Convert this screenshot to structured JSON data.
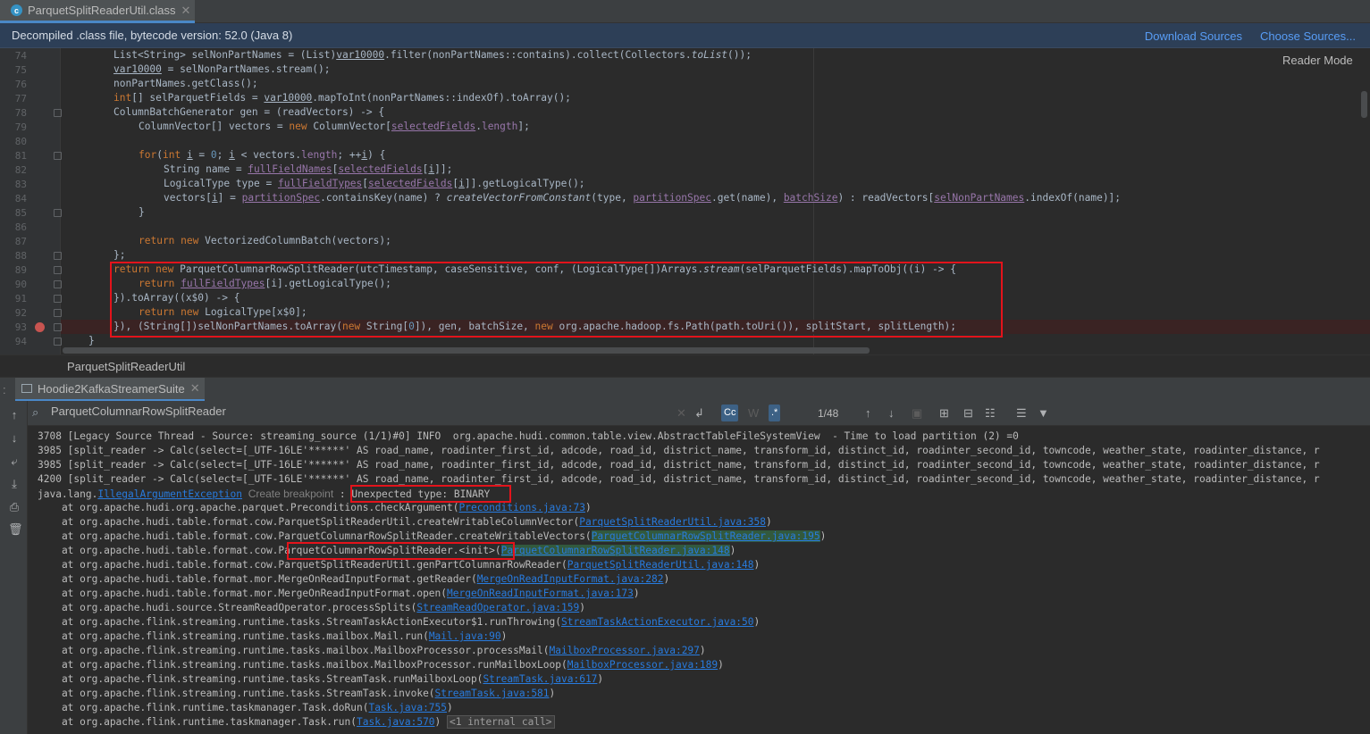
{
  "file_tab": {
    "title": "ParquetSplitReaderUtil.class",
    "icon": "class-file-icon"
  },
  "banner": {
    "message": "Decompiled .class file, bytecode version: 52.0 (Java 8)",
    "download_sources": "Download Sources",
    "choose_sources": "Choose Sources..."
  },
  "editor": {
    "reader_mode": "Reader Mode",
    "breadcrumb": "ParquetSplitReaderUtil",
    "line_numbers": [
      "74",
      "75",
      "76",
      "77",
      "78",
      "79",
      "80",
      "81",
      "82",
      "83",
      "84",
      "85",
      "86",
      "87",
      "88",
      "89",
      "90",
      "91",
      "92",
      "93",
      "94"
    ],
    "breakpoint_line": "93"
  },
  "run_panel": {
    "tab_title": "Hoodie2KafkaStreamerSuite",
    "search_query": "ParquetColumnarRowSplitReader",
    "match_count": "1/48",
    "case_toggle": "Cc",
    "words_toggle": "W",
    "regex_toggle": ".*"
  },
  "console": {
    "exception_class": "java.lang.",
    "exception_name": "IllegalArgumentException",
    "create_breakpoint": "Create breakpoint",
    "exception_message": "Unexpected type: BINARY",
    "internal_calls": "<1 internal call>",
    "log_lines": [
      "3708 [Legacy Source Thread - Source: streaming_source (1/1)#0] INFO  org.apache.hudi.common.table.view.AbstractTableFileSystemView  - Time to load partition (2) =0",
      "3985 [split_reader -> Calc(select=[_UTF-16LE'******' AS road_name, roadinter_first_id, adcode, road_id, district_name, transform_id, distinct_id, roadinter_second_id, towncode, weather_state, roadinter_distance, r",
      "3985 [split_reader -> Calc(select=[_UTF-16LE'******' AS road_name, roadinter_first_id, adcode, road_id, district_name, transform_id, distinct_id, roadinter_second_id, towncode, weather_state, roadinter_distance, r",
      "4200 [split_reader -> Calc(select=[_UTF-16LE'******' AS road_name, roadinter_first_id, adcode, road_id, district_name, transform_id, distinct_id, roadinter_second_id, towncode, weather_state, roadinter_distance, r"
    ],
    "stack_frames": [
      {
        "prefix": "    at org.apache.hudi.org.apache.parquet.Preconditions.checkArgument(",
        "link": "Preconditions.java:73",
        "suffix": ")"
      },
      {
        "prefix": "    at org.apache.hudi.table.format.cow.ParquetSplitReaderUtil.createWritableColumnVector(",
        "link": "ParquetSplitReaderUtil.java:358",
        "suffix": ")"
      },
      {
        "prefix": "    at org.apache.hudi.table.format.cow.ParquetColumnarRowSplitReader.createWritableVectors(",
        "link": "ParquetColumnarRowSplitReader.java:195",
        "suffix": ")"
      },
      {
        "prefix": "    at org.apache.hudi.table.format.cow.ParquetColumnarRowSplitReader.<init>(",
        "link": "ParquetColumnarRowSplitReader.java:148",
        "suffix": ")"
      },
      {
        "prefix": "    at org.apache.hudi.table.format.cow.ParquetSplitReaderUtil.genPartColumnarRowReader(",
        "link": "ParquetSplitReaderUtil.java:148",
        "suffix": ")"
      },
      {
        "prefix": "    at org.apache.hudi.table.format.mor.MergeOnReadInputFormat.getReader(",
        "link": "MergeOnReadInputFormat.java:282",
        "suffix": ")"
      },
      {
        "prefix": "    at org.apache.hudi.table.format.mor.MergeOnReadInputFormat.open(",
        "link": "MergeOnReadInputFormat.java:173",
        "suffix": ")"
      },
      {
        "prefix": "    at org.apache.hudi.source.StreamReadOperator.processSplits(",
        "link": "StreamReadOperator.java:159",
        "suffix": ")"
      },
      {
        "prefix": "    at org.apache.flink.streaming.runtime.tasks.StreamTaskActionExecutor$1.runThrowing(",
        "link": "StreamTaskActionExecutor.java:50",
        "suffix": ")"
      },
      {
        "prefix": "    at org.apache.flink.streaming.runtime.tasks.mailbox.Mail.run(",
        "link": "Mail.java:90",
        "suffix": ")"
      },
      {
        "prefix": "    at org.apache.flink.streaming.runtime.tasks.mailbox.MailboxProcessor.processMail(",
        "link": "MailboxProcessor.java:297",
        "suffix": ")"
      },
      {
        "prefix": "    at org.apache.flink.streaming.runtime.tasks.mailbox.MailboxProcessor.runMailboxLoop(",
        "link": "MailboxProcessor.java:189",
        "suffix": ")"
      },
      {
        "prefix": "    at org.apache.flink.streaming.runtime.tasks.StreamTask.runMailboxLoop(",
        "link": "StreamTask.java:617",
        "suffix": ")"
      },
      {
        "prefix": "    at org.apache.flink.streaming.runtime.tasks.StreamTask.invoke(",
        "link": "StreamTask.java:581",
        "suffix": ")"
      },
      {
        "prefix": "    at org.apache.flink.runtime.taskmanager.Task.doRun(",
        "link": "Task.java:755",
        "suffix": ")"
      },
      {
        "prefix": "    at org.apache.flink.runtime.taskmanager.Task.run(",
        "link": "Task.java:570",
        "suffix": ") "
      }
    ]
  }
}
